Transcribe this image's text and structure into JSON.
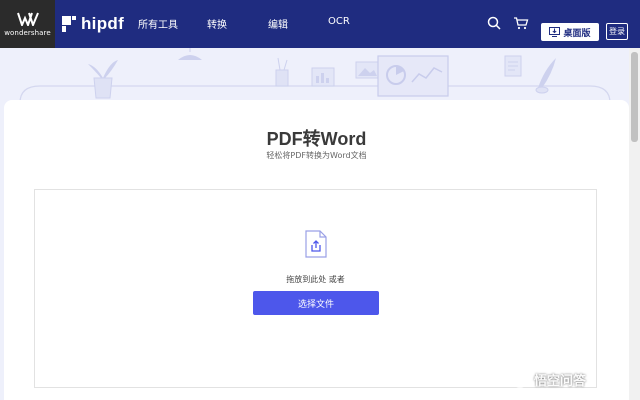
{
  "header": {
    "company": "wondershare",
    "brand": "hipdf",
    "nav": [
      "所有工具",
      "转换",
      "编辑",
      "OCR"
    ],
    "desktop_label": "桌面版",
    "login_label": "登录",
    "icons": [
      "search-icon",
      "cart-icon",
      "desktop-download-icon"
    ]
  },
  "main": {
    "title": "PDF转Word",
    "subtitle": "轻松将PDF转换为Word文档",
    "drop_text": "拖放到此处 或者",
    "select_button": "选择文件",
    "file_icon": "file-upload-icon"
  },
  "colors": {
    "header_bg": "#1f2c80",
    "accent": "#4d57eb",
    "page_bg": "#eef0fb"
  },
  "watermark": "悟空问答"
}
